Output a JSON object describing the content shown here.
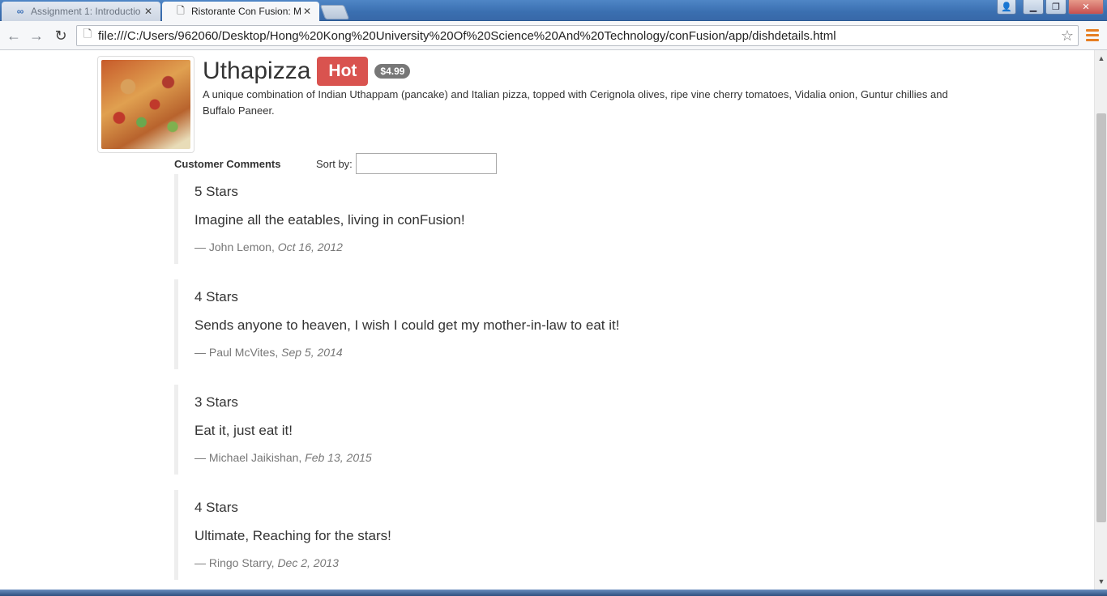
{
  "browser": {
    "tabs": [
      {
        "title": "Assignment 1: Introductio",
        "icon": "coursera-icon",
        "active": false
      },
      {
        "title": "Ristorante Con Fusion: Me",
        "icon": "page-icon",
        "active": true
      }
    ],
    "url": "file:///C:/Users/962060/Desktop/Hong%20Kong%20University%20Of%20Science%20And%20Technology/conFusion/app/dishdetails.html"
  },
  "dish": {
    "name": "Uthapizza",
    "label": "Hot",
    "price": "$4.99",
    "description": "A unique combination of Indian Uthappam (pancake) and Italian pizza, topped with Cerignola olives, ripe vine cherry tomatoes, Vidalia onion, Guntur chillies and Buffalo Paneer."
  },
  "comments_section": {
    "title": "Customer Comments",
    "sort_label": "Sort by:",
    "sort_value": ""
  },
  "comments": [
    {
      "rating": "5 Stars",
      "text": "Imagine all the eatables, living in conFusion!",
      "author": "— John Lemon,",
      "date": "Oct 16, 2012"
    },
    {
      "rating": "4 Stars",
      "text": "Sends anyone to heaven, I wish I could get my mother-in-law to eat it!",
      "author": "— Paul McVites,",
      "date": "Sep 5, 2014"
    },
    {
      "rating": "3 Stars",
      "text": "Eat it, just eat it!",
      "author": "— Michael Jaikishan,",
      "date": "Feb 13, 2015"
    },
    {
      "rating": "4 Stars",
      "text": "Ultimate, Reaching for the stars!",
      "author": "— Ringo Starry,",
      "date": "Dec 2, 2013"
    }
  ]
}
